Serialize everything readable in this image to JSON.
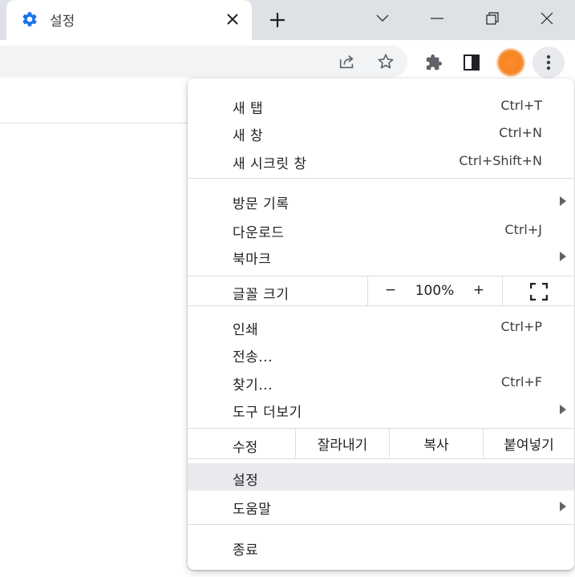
{
  "tab": {
    "title": "설정",
    "close_icon": "close-icon",
    "icon": "gear-icon"
  },
  "colors": {
    "accent": "#1a73e8",
    "menu_highlight": "#e8eaed",
    "tabstrip": "#dee1e6",
    "avatar": "#f68522"
  },
  "menu": {
    "new_tab": {
      "label": "새 탭",
      "shortcut": "Ctrl+T"
    },
    "new_window": {
      "label": "새 창",
      "shortcut": "Ctrl+N"
    },
    "incognito": {
      "label": "새 시크릿 창",
      "shortcut": "Ctrl+Shift+N"
    },
    "history": {
      "label": "방문 기록"
    },
    "downloads": {
      "label": "다운로드",
      "shortcut": "Ctrl+J"
    },
    "bookmarks": {
      "label": "북마크"
    },
    "zoom": {
      "label": "글꼴 크기",
      "minus": "−",
      "value": "100%",
      "plus": "+"
    },
    "print": {
      "label": "인쇄",
      "shortcut": "Ctrl+P"
    },
    "cast": {
      "label": "전송..."
    },
    "find": {
      "label": "찾기...",
      "shortcut": "Ctrl+F"
    },
    "more_tools": {
      "label": "도구 더보기"
    },
    "edit": {
      "label": "수정",
      "cut": "잘라내기",
      "copy": "복사",
      "paste": "붙여넣기"
    },
    "settings": {
      "label": "설정"
    },
    "help": {
      "label": "도움말"
    },
    "exit": {
      "label": "종료"
    }
  }
}
